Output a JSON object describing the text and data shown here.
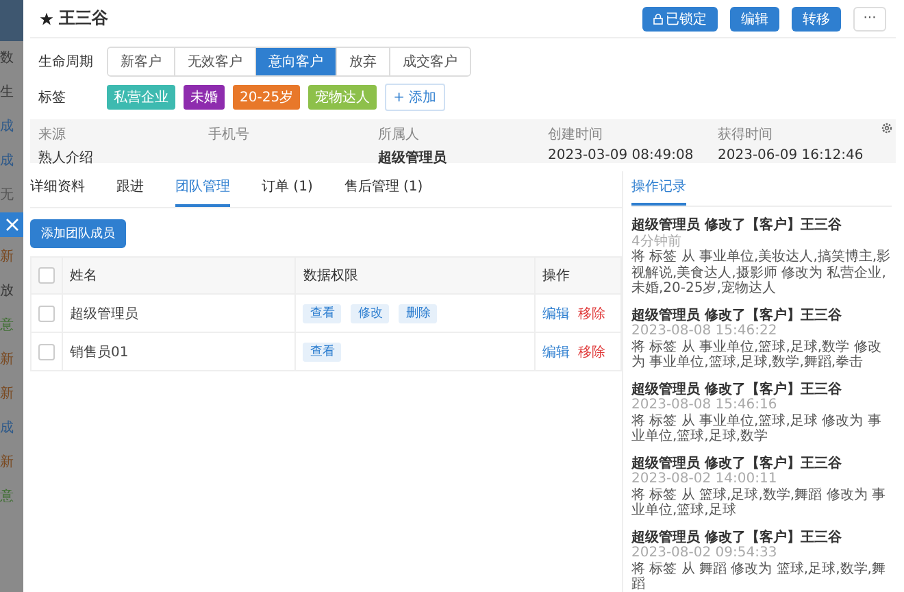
{
  "background_list": {
    "items": [
      {
        "text": "数",
        "color": "#3a3a3a"
      },
      {
        "text": "生",
        "color": "#3a3a3a"
      },
      {
        "text": "成",
        "color": "#2f5a8a"
      },
      {
        "text": "成",
        "color": "#2f5a8a"
      },
      {
        "text": "无",
        "color": "#555555"
      },
      {
        "text": "新",
        "color": "#7a4a22"
      },
      {
        "text": "放",
        "color": "#3a3a3a"
      },
      {
        "text": "意",
        "color": "#3f6f32"
      },
      {
        "text": "新",
        "color": "#7a4a22"
      },
      {
        "text": "新",
        "color": "#7a4a22"
      },
      {
        "text": "成",
        "color": "#2f5a8a"
      },
      {
        "text": "新",
        "color": "#7a4a22"
      },
      {
        "text": "意",
        "color": "#3f6f32"
      }
    ]
  },
  "header": {
    "title": "王三谷",
    "starred": true,
    "buttons": [
      {
        "label": "已锁定",
        "kind": "lock"
      },
      {
        "label": "编辑",
        "kind": "primary"
      },
      {
        "label": "转移",
        "kind": "primary"
      },
      {
        "label": "···",
        "kind": "more"
      }
    ]
  },
  "lifecycle": {
    "label": "生命周期",
    "options": [
      {
        "label": "新客户",
        "selected": false
      },
      {
        "label": "无效客户",
        "selected": false
      },
      {
        "label": "意向客户",
        "selected": true
      },
      {
        "label": "放弃",
        "selected": false
      },
      {
        "label": "成交客户",
        "selected": false
      }
    ]
  },
  "tags": {
    "label": "标签",
    "items": [
      {
        "text": "私营企业",
        "color": "#3dbab0"
      },
      {
        "text": "未婚",
        "color": "#8e2cae"
      },
      {
        "text": "20-25岁",
        "color": "#e8782a"
      },
      {
        "text": "宠物达人",
        "color": "#8dc04a"
      }
    ],
    "add_label": "+ 添加"
  },
  "info": [
    {
      "label": "来源",
      "value": "熟人介绍"
    },
    {
      "label": "手机号"
    },
    {
      "label": "所属人",
      "value": "超级管理员"
    },
    {
      "label": "创建时间",
      "value": "2023-03-09 08:49:08"
    },
    {
      "label": "获得时间",
      "value": "2023-06-09 16:12:46"
    }
  ],
  "tabs": [
    {
      "label": "详细资料",
      "selected": false
    },
    {
      "label": "跟进",
      "selected": false
    },
    {
      "label": "团队管理",
      "selected": true
    },
    {
      "label": "订单 (1)",
      "selected": false
    },
    {
      "label": "售后管理 (1)",
      "selected": false
    }
  ],
  "add_member_button": "添加团队成员",
  "table": {
    "header_checked": false,
    "columns": [
      "姓名",
      "数据权限",
      "操作"
    ],
    "rows": [
      {
        "checked": false,
        "name": "超级管理员",
        "permissions": [
          "查看",
          "修改",
          "删除"
        ],
        "actions": [
          "编辑",
          "移除"
        ]
      },
      {
        "checked": false,
        "name": "销售员01",
        "permissions": [
          "查看"
        ],
        "actions": [
          "编辑",
          "移除"
        ]
      }
    ]
  },
  "log": {
    "tab": "操作记录",
    "entries": [
      {
        "title": "超级管理员 修改了【客户】王三谷",
        "time": "4分钟前",
        "body": "将 标签 从 事业单位,美妆达人,搞笑博主,影视解说,美食达人,摄影师 修改为 私营企业,未婚,20-25岁,宠物达人"
      },
      {
        "title": "超级管理员 修改了【客户】王三谷",
        "time": "2023-08-08 15:46:22",
        "body": "将 标签 从 事业单位,篮球,足球,数学 修改为 事业单位,篮球,足球,数学,舞蹈,拳击"
      },
      {
        "title": "超级管理员 修改了【客户】王三谷",
        "time": "2023-08-08 15:46:16",
        "body": "将 标签 从 事业单位,篮球,足球 修改为 事业单位,篮球,足球,数学"
      },
      {
        "title": "超级管理员 修改了【客户】王三谷",
        "time": "2023-08-02 14:00:11",
        "body": "将 标签 从 篮球,足球,数学,舞蹈 修改为 事业单位,篮球,足球"
      },
      {
        "title": "超级管理员 修改了【客户】王三谷",
        "time": "2023-08-02 09:54:33",
        "body": "将 标签 从 舞蹈 修改为 篮球,足球,数学,舞蹈"
      }
    ]
  }
}
